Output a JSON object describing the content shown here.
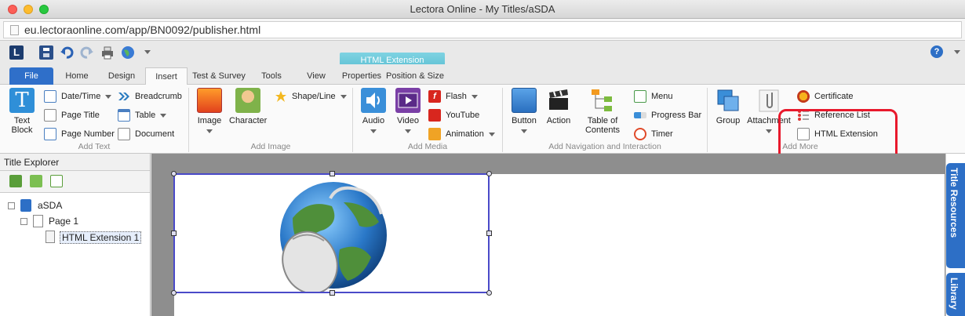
{
  "window": {
    "title": "Lectora Online - My Titles/aSDA"
  },
  "browser": {
    "url": "eu.lectoraonline.com/app/BN0092/publisher.html"
  },
  "contextual_tab": {
    "header": "HTML Extension",
    "tabs": [
      "Properties",
      "Position & Size"
    ]
  },
  "tabs": [
    "File",
    "Home",
    "Design",
    "Insert",
    "Test & Survey",
    "Tools",
    "View"
  ],
  "active_tab": "Insert",
  "ribbon": {
    "add_text": {
      "label": "Add Text",
      "text_block": "Text Block",
      "date_time": "Date/Time",
      "page_title": "Page Title",
      "page_number": "Page Number",
      "breadcrumb": "Breadcrumb",
      "table": "Table",
      "document": "Document"
    },
    "add_image": {
      "label": "Add Image",
      "image": "Image",
      "character": "Character",
      "shape_line": "Shape/Line"
    },
    "add_media": {
      "label": "Add Media",
      "audio": "Audio",
      "video": "Video",
      "flash": "Flash",
      "youtube": "YouTube",
      "animation": "Animation"
    },
    "add_navigation": {
      "label": "Add Navigation and Interaction",
      "button": "Button",
      "action": "Action",
      "toc": "Table of Contents",
      "menu": "Menu",
      "progress_bar": "Progress Bar",
      "timer": "Timer"
    },
    "add_more": {
      "label": "Add More",
      "group": "Group",
      "attachment": "Attachment",
      "certificate": "Certificate",
      "reference_list": "Reference List",
      "html_extension": "HTML Extension"
    }
  },
  "explorer": {
    "title": "Title Explorer",
    "tree": [
      {
        "label": "aSDA",
        "level": 0
      },
      {
        "label": "Page 1",
        "level": 1
      },
      {
        "label": "HTML Extension 1",
        "level": 2,
        "selected": true
      }
    ]
  },
  "side_tabs": [
    "Title Resources",
    "Library"
  ],
  "colors": {
    "accent": "#2f6fc9",
    "highlight": "#e8192c",
    "selection": "#4a4ac8",
    "context_tab": "#5ec0d4"
  }
}
